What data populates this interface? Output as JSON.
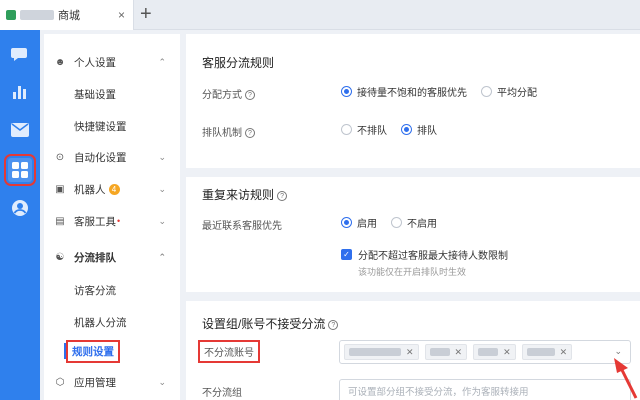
{
  "tab": {
    "title": "商城",
    "close": "×",
    "add": "+"
  },
  "sidebar": {
    "items": [
      {
        "label": "个人设置",
        "icon": "user-icon"
      },
      {
        "label": "基础设置"
      },
      {
        "label": "快捷键设置"
      },
      {
        "label": "自动化设置",
        "icon": "headset-icon"
      },
      {
        "label": "机器人",
        "icon": "robot-icon",
        "badge": "4"
      },
      {
        "label": "客服工具",
        "icon": "toolbox-icon",
        "dot": "•"
      },
      {
        "label": "分流排队",
        "icon": "org-icon"
      },
      {
        "label": "访客分流"
      },
      {
        "label": "机器人分流"
      },
      {
        "label": "规则设置"
      },
      {
        "label": "应用管理",
        "icon": "cube-icon"
      }
    ]
  },
  "main": {
    "section1": {
      "title": "客服分流规则",
      "assign_label": "分配方式",
      "assign_options": [
        "接待量不饱和的客服优先",
        "平均分配"
      ],
      "queue_label": "排队机制",
      "queue_options": [
        "不排队",
        "排队"
      ]
    },
    "section2": {
      "title": "重复来访规则",
      "recent_label": "最近联系客服优先",
      "recent_options": [
        "启用",
        "不启用"
      ],
      "limit_check": "分配不超过客服最大接待人数限制",
      "limit_hint": "该功能仅在开启排队时生效"
    },
    "section3": {
      "title": "设置组/账号不接受分流",
      "account_label": "不分流账号",
      "group_label": "不分流组",
      "group_placeholder": "可设置部分组不接受分流，作为客服转接用"
    }
  },
  "colors": {
    "accent": "#2f6fed",
    "rail": "#2f80ed",
    "highlight": "#e53935"
  }
}
